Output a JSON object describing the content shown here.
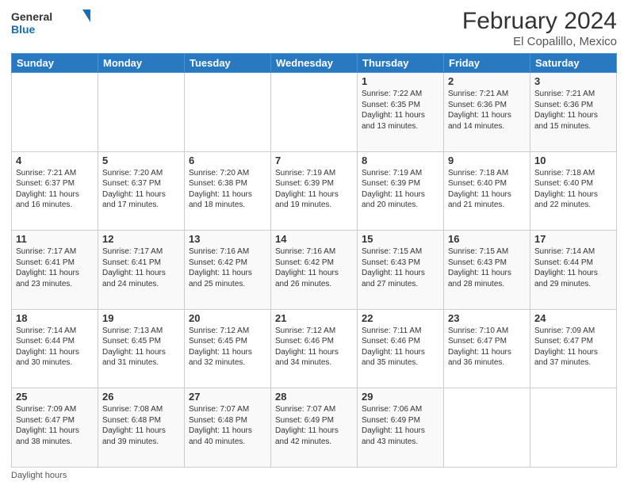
{
  "header": {
    "logo_general": "General",
    "logo_blue": "Blue",
    "month_year": "February 2024",
    "location": "El Copalillo, Mexico"
  },
  "weekdays": [
    "Sunday",
    "Monday",
    "Tuesday",
    "Wednesday",
    "Thursday",
    "Friday",
    "Saturday"
  ],
  "footer": {
    "daylight_label": "Daylight hours"
  },
  "weeks": [
    [
      {
        "day": "",
        "sunrise": "",
        "sunset": "",
        "daylight": ""
      },
      {
        "day": "",
        "sunrise": "",
        "sunset": "",
        "daylight": ""
      },
      {
        "day": "",
        "sunrise": "",
        "sunset": "",
        "daylight": ""
      },
      {
        "day": "",
        "sunrise": "",
        "sunset": "",
        "daylight": ""
      },
      {
        "day": "1",
        "sunrise": "Sunrise: 7:22 AM",
        "sunset": "Sunset: 6:35 PM",
        "daylight": "Daylight: 11 hours and 13 minutes."
      },
      {
        "day": "2",
        "sunrise": "Sunrise: 7:21 AM",
        "sunset": "Sunset: 6:36 PM",
        "daylight": "Daylight: 11 hours and 14 minutes."
      },
      {
        "day": "3",
        "sunrise": "Sunrise: 7:21 AM",
        "sunset": "Sunset: 6:36 PM",
        "daylight": "Daylight: 11 hours and 15 minutes."
      }
    ],
    [
      {
        "day": "4",
        "sunrise": "Sunrise: 7:21 AM",
        "sunset": "Sunset: 6:37 PM",
        "daylight": "Daylight: 11 hours and 16 minutes."
      },
      {
        "day": "5",
        "sunrise": "Sunrise: 7:20 AM",
        "sunset": "Sunset: 6:37 PM",
        "daylight": "Daylight: 11 hours and 17 minutes."
      },
      {
        "day": "6",
        "sunrise": "Sunrise: 7:20 AM",
        "sunset": "Sunset: 6:38 PM",
        "daylight": "Daylight: 11 hours and 18 minutes."
      },
      {
        "day": "7",
        "sunrise": "Sunrise: 7:19 AM",
        "sunset": "Sunset: 6:39 PM",
        "daylight": "Daylight: 11 hours and 19 minutes."
      },
      {
        "day": "8",
        "sunrise": "Sunrise: 7:19 AM",
        "sunset": "Sunset: 6:39 PM",
        "daylight": "Daylight: 11 hours and 20 minutes."
      },
      {
        "day": "9",
        "sunrise": "Sunrise: 7:18 AM",
        "sunset": "Sunset: 6:40 PM",
        "daylight": "Daylight: 11 hours and 21 minutes."
      },
      {
        "day": "10",
        "sunrise": "Sunrise: 7:18 AM",
        "sunset": "Sunset: 6:40 PM",
        "daylight": "Daylight: 11 hours and 22 minutes."
      }
    ],
    [
      {
        "day": "11",
        "sunrise": "Sunrise: 7:17 AM",
        "sunset": "Sunset: 6:41 PM",
        "daylight": "Daylight: 11 hours and 23 minutes."
      },
      {
        "day": "12",
        "sunrise": "Sunrise: 7:17 AM",
        "sunset": "Sunset: 6:41 PM",
        "daylight": "Daylight: 11 hours and 24 minutes."
      },
      {
        "day": "13",
        "sunrise": "Sunrise: 7:16 AM",
        "sunset": "Sunset: 6:42 PM",
        "daylight": "Daylight: 11 hours and 25 minutes."
      },
      {
        "day": "14",
        "sunrise": "Sunrise: 7:16 AM",
        "sunset": "Sunset: 6:42 PM",
        "daylight": "Daylight: 11 hours and 26 minutes."
      },
      {
        "day": "15",
        "sunrise": "Sunrise: 7:15 AM",
        "sunset": "Sunset: 6:43 PM",
        "daylight": "Daylight: 11 hours and 27 minutes."
      },
      {
        "day": "16",
        "sunrise": "Sunrise: 7:15 AM",
        "sunset": "Sunset: 6:43 PM",
        "daylight": "Daylight: 11 hours and 28 minutes."
      },
      {
        "day": "17",
        "sunrise": "Sunrise: 7:14 AM",
        "sunset": "Sunset: 6:44 PM",
        "daylight": "Daylight: 11 hours and 29 minutes."
      }
    ],
    [
      {
        "day": "18",
        "sunrise": "Sunrise: 7:14 AM",
        "sunset": "Sunset: 6:44 PM",
        "daylight": "Daylight: 11 hours and 30 minutes."
      },
      {
        "day": "19",
        "sunrise": "Sunrise: 7:13 AM",
        "sunset": "Sunset: 6:45 PM",
        "daylight": "Daylight: 11 hours and 31 minutes."
      },
      {
        "day": "20",
        "sunrise": "Sunrise: 7:12 AM",
        "sunset": "Sunset: 6:45 PM",
        "daylight": "Daylight: 11 hours and 32 minutes."
      },
      {
        "day": "21",
        "sunrise": "Sunrise: 7:12 AM",
        "sunset": "Sunset: 6:46 PM",
        "daylight": "Daylight: 11 hours and 34 minutes."
      },
      {
        "day": "22",
        "sunrise": "Sunrise: 7:11 AM",
        "sunset": "Sunset: 6:46 PM",
        "daylight": "Daylight: 11 hours and 35 minutes."
      },
      {
        "day": "23",
        "sunrise": "Sunrise: 7:10 AM",
        "sunset": "Sunset: 6:47 PM",
        "daylight": "Daylight: 11 hours and 36 minutes."
      },
      {
        "day": "24",
        "sunrise": "Sunrise: 7:09 AM",
        "sunset": "Sunset: 6:47 PM",
        "daylight": "Daylight: 11 hours and 37 minutes."
      }
    ],
    [
      {
        "day": "25",
        "sunrise": "Sunrise: 7:09 AM",
        "sunset": "Sunset: 6:47 PM",
        "daylight": "Daylight: 11 hours and 38 minutes."
      },
      {
        "day": "26",
        "sunrise": "Sunrise: 7:08 AM",
        "sunset": "Sunset: 6:48 PM",
        "daylight": "Daylight: 11 hours and 39 minutes."
      },
      {
        "day": "27",
        "sunrise": "Sunrise: 7:07 AM",
        "sunset": "Sunset: 6:48 PM",
        "daylight": "Daylight: 11 hours and 40 minutes."
      },
      {
        "day": "28",
        "sunrise": "Sunrise: 7:07 AM",
        "sunset": "Sunset: 6:49 PM",
        "daylight": "Daylight: 11 hours and 42 minutes."
      },
      {
        "day": "29",
        "sunrise": "Sunrise: 7:06 AM",
        "sunset": "Sunset: 6:49 PM",
        "daylight": "Daylight: 11 hours and 43 minutes."
      },
      {
        "day": "",
        "sunrise": "",
        "sunset": "",
        "daylight": ""
      },
      {
        "day": "",
        "sunrise": "",
        "sunset": "",
        "daylight": ""
      }
    ]
  ]
}
